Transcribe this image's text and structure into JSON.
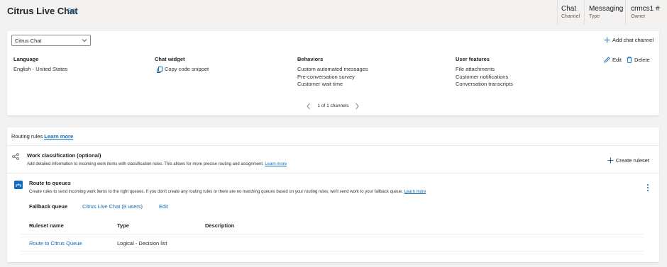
{
  "header": {
    "title": "Citrus Live Chat",
    "edit_label": "Edit",
    "meta": [
      {
        "value": "Chat",
        "label": "Channel"
      },
      {
        "value": "Messaging",
        "label": "Type"
      },
      {
        "value": "crmcs1 #",
        "label": "Owner"
      }
    ]
  },
  "channel": {
    "selected": "Citrus Chat",
    "add_label": "Add chat channel",
    "language": {
      "heading": "Language",
      "value": "English - United States"
    },
    "widget": {
      "heading": "Chat widget",
      "copy_label": "Copy code snippet"
    },
    "behaviors": {
      "heading": "Behaviors",
      "items": [
        "Custom automated messages",
        "Pre-conversation survey",
        "Customer wait time"
      ]
    },
    "user_features": {
      "heading": "User features",
      "items": [
        "File attachments",
        "Customer notifications",
        "Conversation transcripts"
      ]
    },
    "edit_label": "Edit",
    "delete_label": "Delete",
    "pager": "1 of 1 channels"
  },
  "routing": {
    "title": "Routing rules",
    "learn_more": "Learn more",
    "work_classification": {
      "title": "Work classification (optional)",
      "desc": "Add detailed information to incoming work items with classification rules. This allows for more precise routing and assignment.",
      "learn_more": "Learn more",
      "create_label": "Create ruleset"
    },
    "route_to_queues": {
      "title": "Route to queues",
      "desc": "Create rules to send incoming work items to the right queues. If you don't create any routing rules or there are no matching queues based on your routing rules, we'll send work to your fallback queue.",
      "learn_more": "Learn more",
      "fallback_label": "Fallback queue",
      "fallback_value": "Citrus Live Chat (8 users)",
      "fallback_edit": "Edit",
      "columns": [
        "Ruleset name",
        "Type",
        "Description"
      ],
      "rows": [
        {
          "name": "Route to Citrus Queue",
          "type": "Logical - Decision list",
          "description": ""
        }
      ]
    }
  },
  "colors": {
    "accent": "#0f6cbd",
    "background": "#f3f2f1"
  }
}
